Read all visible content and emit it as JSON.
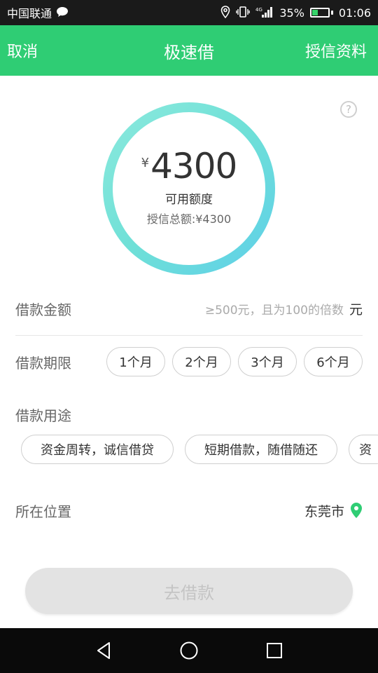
{
  "status_bar": {
    "carrier": "中国联通",
    "signal_label": "4G",
    "battery": "35%",
    "battery_level": 0.35,
    "time": "01:06"
  },
  "header": {
    "cancel": "取消",
    "title": "极速借",
    "credit_info": "授信资料",
    "bg_color": "#2fcd74"
  },
  "credit": {
    "currency_symbol": "¥",
    "available_amount": "4300",
    "available_label": "可用额度",
    "total_label": "授信总额:¥4300",
    "help_symbol": "?"
  },
  "loan_amount": {
    "label": "借款金额",
    "placeholder": "≥500元，且为100的倍数",
    "unit": "元"
  },
  "loan_term": {
    "label": "借款期限",
    "options": [
      "1个月",
      "2个月",
      "3个月",
      "6个月"
    ]
  },
  "loan_purpose": {
    "label": "借款用途",
    "options": [
      "资金周转，诚信借贷",
      "短期借款，随借随还",
      "资"
    ]
  },
  "location": {
    "label": "所在位置",
    "city": "东莞市",
    "pin_color": "#2fcd74"
  },
  "submit": {
    "label": "去借款"
  },
  "icons": {
    "help": "question-icon",
    "location": "map-pin-icon",
    "nav_back": "back-triangle-icon",
    "nav_home": "home-circle-icon",
    "nav_recent": "recent-square-icon"
  }
}
